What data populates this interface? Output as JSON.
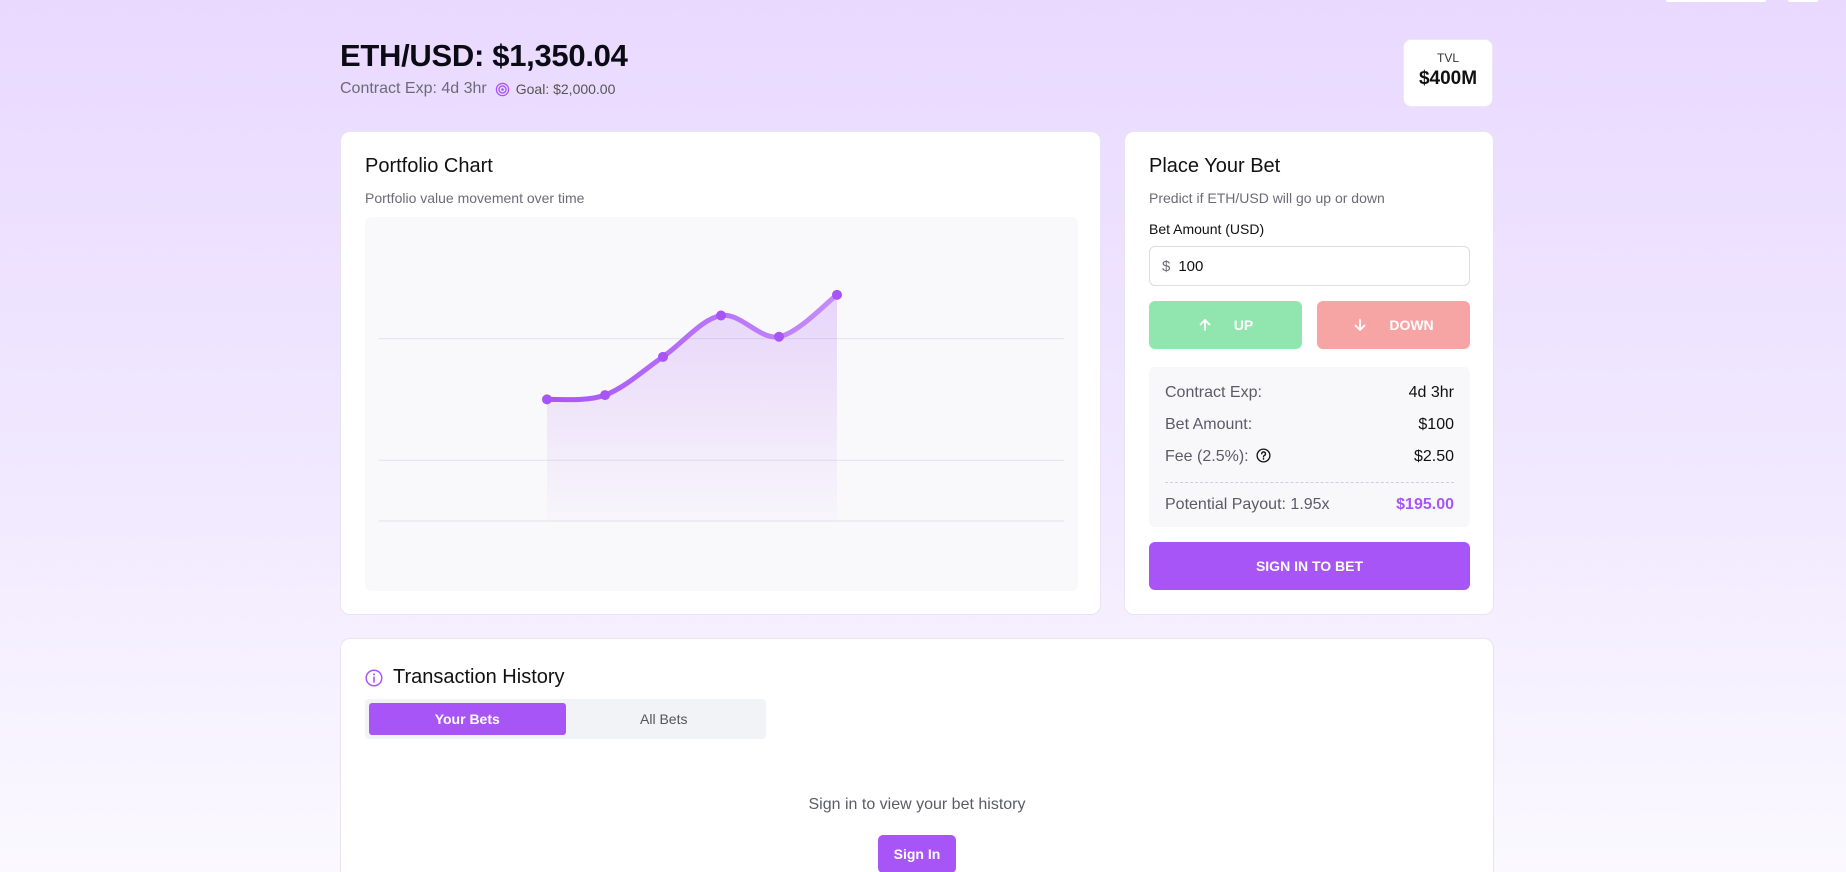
{
  "header": {
    "title": "ETH/USD: $1,350.04",
    "contract_exp": "Contract Exp: 4d 3hr",
    "goal": "Goal: $2,000.00"
  },
  "tvl": {
    "label": "TVL",
    "value": "$400M"
  },
  "chart_card": {
    "title": "Portfolio Chart",
    "description": "Portfolio value movement over time"
  },
  "chart_data": {
    "type": "area",
    "title": "",
    "xlabel": "",
    "ylabel": "",
    "grid": true,
    "x": [
      1,
      2,
      3,
      4,
      5,
      6
    ],
    "values": [
      900,
      907,
      970,
      1038,
      1003,
      1072
    ],
    "ylim": [
      700,
      1200
    ],
    "colors": {
      "line": "#a855f7",
      "fill": "#a855f7"
    }
  },
  "bet": {
    "title": "Place Your Bet",
    "description": "Predict if ETH/USD will go up or down",
    "amount_label": "Bet Amount (USD)",
    "currency_symbol": "$",
    "amount_value": "100",
    "up_label": "UP",
    "down_label": "DOWN",
    "summary": {
      "contract_exp_label": "Contract Exp:",
      "contract_exp_value": "4d 3hr",
      "bet_amount_label": "Bet Amount:",
      "bet_amount_value": "$100",
      "fee_label": "Fee (2.5%):",
      "fee_value": "$2.50",
      "payout_label": "Potential Payout: 1.95x",
      "payout_value": "$195.00"
    },
    "signin_label": "SIGN IN TO BET"
  },
  "transactions": {
    "title": "Transaction History",
    "tabs": [
      "Your Bets",
      "All Bets"
    ],
    "active_tab": "Your Bets",
    "empty_message": "Sign in to view your bet history",
    "signin_label": "Sign In"
  },
  "colors": {
    "accent": "#a855f7",
    "up": "#90e6ae",
    "down": "#f7a4a4"
  }
}
